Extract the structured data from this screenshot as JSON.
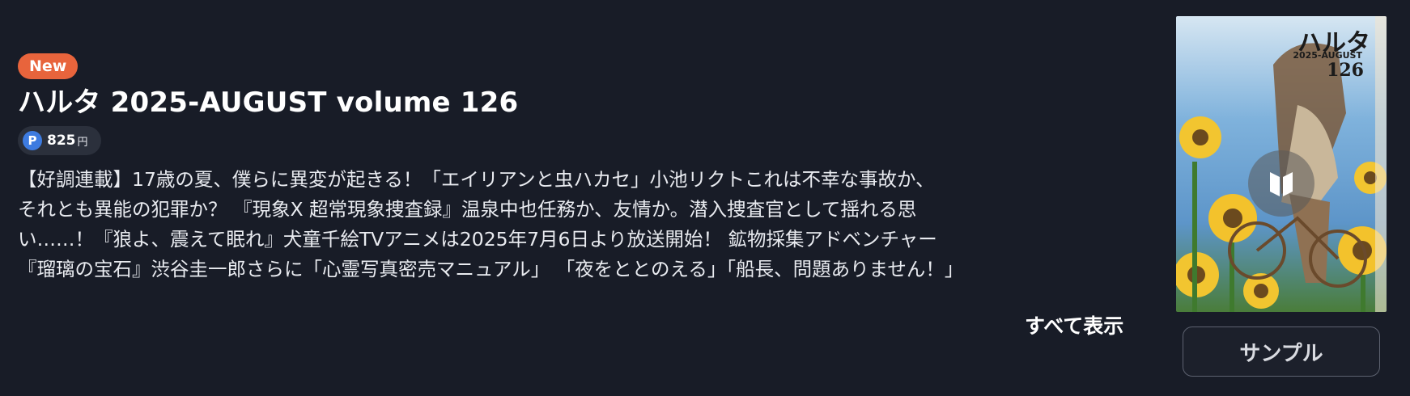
{
  "item": {
    "badge": "New",
    "title": "ハルタ 2025-AUGUST volume 126",
    "price": {
      "icon_letter": "P",
      "value": "825",
      "unit": "円"
    },
    "description_lines": [
      "【好調連載】17歳の夏、僕らに異変が起きる！「エイリアンと虫ハカセ」小池リクトこれは不幸な事故か、",
      "それとも異能の犯罪か？ 『現象X 超常現象捜査録』温泉中也任務か、友情か。潜入捜査官として揺れる思",
      "い……！『狼よ、震えて眠れ』犬童千絵TVアニメは2025年7月6日より放送開始！ 鉱物採集アドベンチャー",
      "『瑠璃の宝石』渋谷圭一郎さらに「心霊写真密売マニュアル」 「夜をととのえる」「船長、問題ありません！」"
    ],
    "show_all_label": "すべて表示",
    "sample_label": "サンプル"
  },
  "cover": {
    "title": "ハルタ",
    "subtitle": "2025-AUGUST",
    "number": "126"
  },
  "icons": {
    "point": "point-coin-icon",
    "reader": "book-open-icon"
  },
  "colors": {
    "background": "#181c27",
    "badge": "#e8643c",
    "point": "#3d7be0",
    "chip": "#2b303c",
    "sample_border": "#5d6270"
  }
}
